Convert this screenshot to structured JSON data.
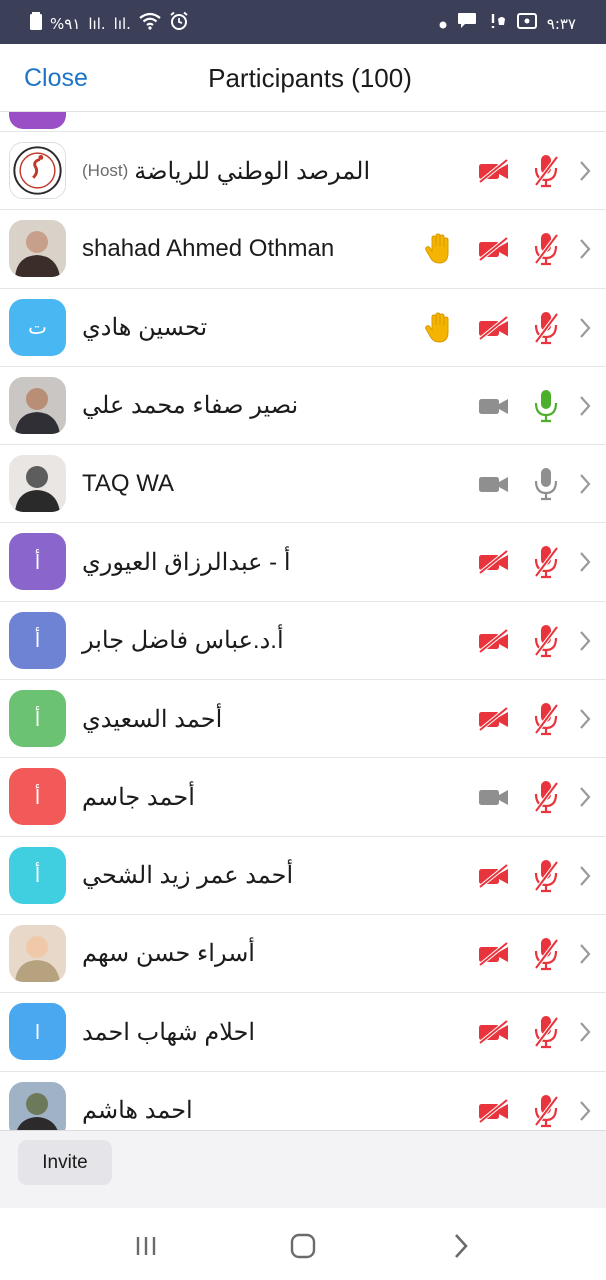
{
  "status_bar": {
    "battery": "%٩١",
    "signal_1": "lıl.",
    "signal_2": "lıl.",
    "time": "٩:٣٧"
  },
  "header": {
    "close_label": "Close",
    "title": "Participants (100)"
  },
  "colors": {
    "accent_blue": "#1e74c8",
    "muted_red": "#e8343c",
    "mic_green": "#4caf2c",
    "icon_gray": "#8f8f8f",
    "raised_hand": "#f5b400"
  },
  "participants": [
    {
      "name": "المرصد الوطني للرياضة",
      "tag": "(Host)",
      "avatar": "logo",
      "hand": false,
      "video": "off",
      "audio": "muted"
    },
    {
      "name": "shahad Ahmed Othman",
      "tag": "",
      "avatar": "photo",
      "hand": true,
      "video": "off",
      "audio": "muted"
    },
    {
      "name": "تحسين هادي",
      "tag": "",
      "avatar": "ت",
      "avatar_color": "#49b7f2",
      "hand": true,
      "video": "off",
      "audio": "muted"
    },
    {
      "name": "نصير صفاء محمد علي",
      "tag": "",
      "avatar": "photo",
      "hand": false,
      "video": "on",
      "audio": "active"
    },
    {
      "name": "TAQ WA",
      "tag": "",
      "avatar": "photo",
      "hand": false,
      "video": "on",
      "audio": "unmuted"
    },
    {
      "name": "أ - عبدالرزاق العيوري",
      "tag": "",
      "avatar": "أ",
      "avatar_color": "#8a66cc",
      "hand": false,
      "video": "off",
      "audio": "muted"
    },
    {
      "name": "أ.د.عباس فاضل جابر",
      "tag": "",
      "avatar": "أ",
      "avatar_color": "#6f83d4",
      "hand": false,
      "video": "off",
      "audio": "muted"
    },
    {
      "name": "أحمد السعيدي",
      "tag": "",
      "avatar": "أ",
      "avatar_color": "#6ac272",
      "hand": false,
      "video": "off",
      "audio": "muted"
    },
    {
      "name": "أحمد جاسم",
      "tag": "",
      "avatar": "أ",
      "avatar_color": "#f25a5a",
      "hand": false,
      "video": "on",
      "audio": "muted"
    },
    {
      "name": "أحمد عمر زيد الشحي",
      "tag": "",
      "avatar": "أ",
      "avatar_color": "#3fcfe0",
      "hand": false,
      "video": "off",
      "audio": "muted"
    },
    {
      "name": "أسراء حسن سهم",
      "tag": "",
      "avatar": "photo",
      "hand": false,
      "video": "off",
      "audio": "muted"
    },
    {
      "name": "احلام شهاب احمد",
      "tag": "",
      "avatar": "ا",
      "avatar_color": "#4aa8f0",
      "hand": false,
      "video": "off",
      "audio": "muted"
    },
    {
      "name": "احمد هاشم",
      "tag": "",
      "avatar": "photo",
      "hand": false,
      "video": "off",
      "audio": "muted"
    }
  ],
  "footer": {
    "invite_label": "Invite"
  },
  "nav_icons": [
    "recent-apps-icon",
    "home-icon",
    "back-icon"
  ]
}
